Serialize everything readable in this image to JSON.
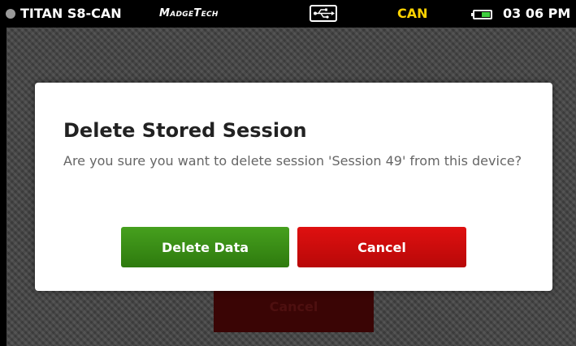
{
  "status_bar": {
    "device_name": "TITAN S8-CAN",
    "brand": "MadgeTech",
    "mode": "CAN",
    "clock": "03 06 PM",
    "colors": {
      "mode": "#ffd200",
      "battery": "#3fcf3f"
    },
    "icons": [
      "status-dot-icon",
      "usb-icon",
      "battery-icon"
    ]
  },
  "background": {
    "cancel_label": "Cancel"
  },
  "dialog": {
    "title": "Delete Stored Session",
    "message": "Are you sure you want to delete session 'Session 49' from this device?",
    "delete_label": "Delete Data",
    "cancel_label": "Cancel",
    "colors": {
      "delete": "#3a8f16",
      "cancel": "#d40c0c"
    }
  }
}
